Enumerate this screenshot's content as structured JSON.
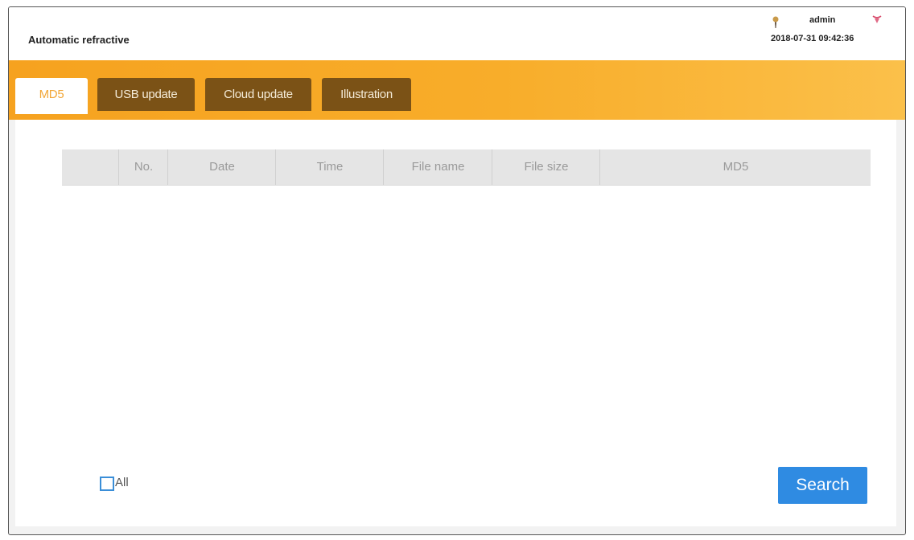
{
  "header": {
    "title": "Automatic refractive",
    "username": "admin",
    "datetime": "2018-07-31 09:42:36",
    "user_icon": "user-icon",
    "logout_icon": "logout-icon"
  },
  "tabs": [
    {
      "label": "MD5",
      "active": true
    },
    {
      "label": "USB update",
      "active": false
    },
    {
      "label": "Cloud update",
      "active": false
    },
    {
      "label": "Illustration",
      "active": false
    }
  ],
  "table": {
    "columns": [
      "",
      "No.",
      "Date",
      "Time",
      "File name",
      "File size",
      "MD5"
    ],
    "rows": []
  },
  "footer": {
    "all_label": "All",
    "all_checked": false,
    "search_label": "Search"
  },
  "colors": {
    "accent_orange": "#f6a21f",
    "tab_inactive": "#7b5216",
    "button_blue": "#2f8be2"
  }
}
